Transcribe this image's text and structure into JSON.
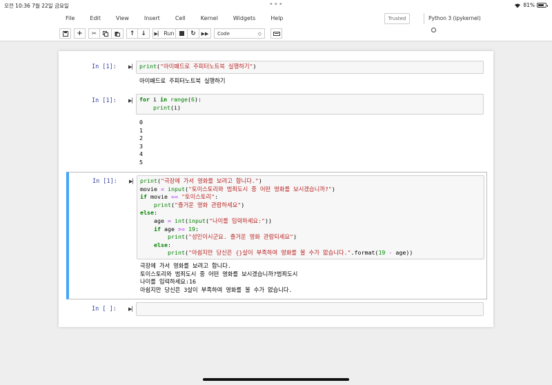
{
  "status_bar": {
    "time": "오전 10:36",
    "date": "7월 22일 금요일",
    "battery": "81%"
  },
  "menu": [
    "File",
    "Edit",
    "View",
    "Insert",
    "Cell",
    "Kernel",
    "Widgets",
    "Help"
  ],
  "trusted_label": "Trusted",
  "kernel_label": "Python 3 (ipykernel)",
  "toolbar": {
    "run_label": "Run",
    "cell_type": "Code",
    "cell_type_arrow": "◇"
  },
  "cells": [
    {
      "prompt": "In [1]:",
      "code": [
        "print(\"아이패드로 주피터노트북 실행하기\")"
      ],
      "output": [
        "아이패드로 주피터노트북 실행하기"
      ]
    },
    {
      "prompt": "In [1]:",
      "code": [
        "for i in range(6):",
        "    print(i)"
      ],
      "output": [
        "0",
        "1",
        "2",
        "3",
        "4",
        "5"
      ]
    },
    {
      "prompt": "In [1]:",
      "code": [
        "print(\"극장에 가서 영화를 보려고 합니다.\")",
        "movie = input(\"토이스토리와 범죄도시 중 어떤 영화를 보시겠습니까?\")",
        "if movie == \"토이스토리\":",
        "    print(\"즐거운 영화 관람하세요\")",
        "else:",
        "    age = int(input(\"나이를 입력하세요:\"))",
        "    if age >= 19:",
        "        print(\"성인이시군요. 즐거운 영화 관람되세요\")",
        "    else:",
        "        print(\"아쉽지만 당신은 {}살이 부족하여 영화를 볼 수가 없습니다.\".format(19 - age))"
      ],
      "output": [
        "극장에 가서 영화를 보려고 합니다.",
        "토이스토리와 범죄도시 중 어떤 영화를 보시겠습니까?범죄도시",
        "나이를 입력하세요:16",
        "아쉽지만 당신은 3살이 부족하여 영화를 볼 수가 없습니다."
      ]
    },
    {
      "prompt": "In [ ]:",
      "code": [
        ""
      ],
      "output": []
    }
  ]
}
